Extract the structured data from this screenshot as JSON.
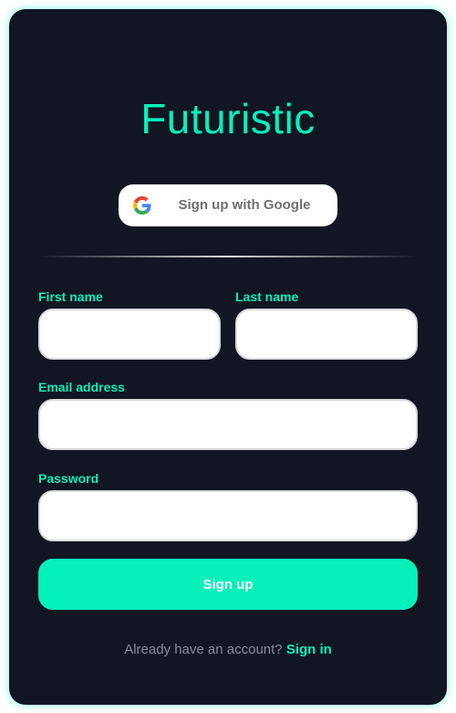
{
  "app": {
    "title": "Futuristic"
  },
  "google_button": {
    "label": "Sign up with Google",
    "icon": "google-g-icon"
  },
  "form": {
    "first_name": {
      "label": "First name",
      "value": "",
      "placeholder": ""
    },
    "last_name": {
      "label": "Last name",
      "value": "",
      "placeholder": ""
    },
    "email": {
      "label": "Email address",
      "value": "",
      "placeholder": ""
    },
    "password": {
      "label": "Password",
      "value": "",
      "placeholder": ""
    },
    "submit_label": "Sign up"
  },
  "footer": {
    "prompt": "Already have an account?",
    "link_label": "Sign in"
  },
  "colors": {
    "accent": "#06f0ba",
    "card_background": "#121522",
    "input_background": "#ffffff",
    "muted_text": "#8a8d97"
  }
}
